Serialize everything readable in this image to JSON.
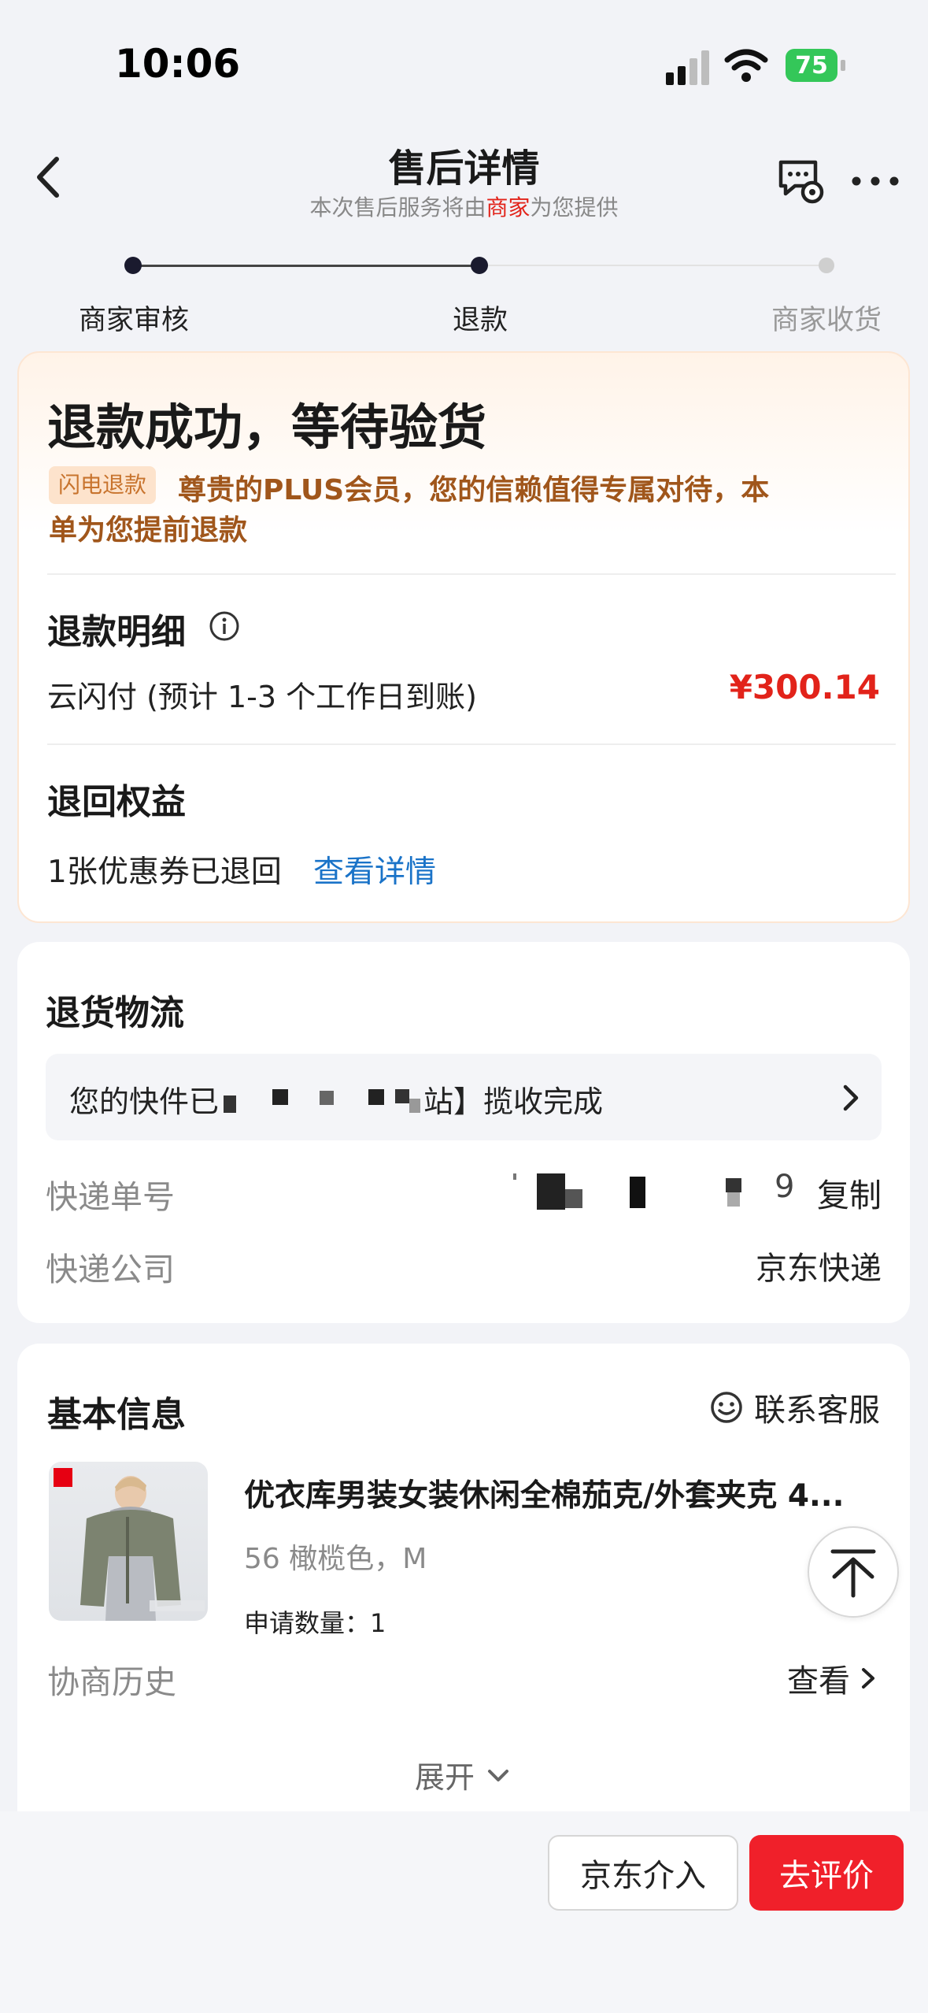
{
  "status_bar": {
    "time": "10:06",
    "battery": "75"
  },
  "header": {
    "title": "售后详情",
    "subtitle_prefix": "本次售后服务将由",
    "subtitle_highlight": "商家",
    "subtitle_suffix": "为您提供"
  },
  "progress": {
    "steps": [
      {
        "label": "商家审核",
        "state": "done"
      },
      {
        "label": "退款",
        "state": "current"
      },
      {
        "label": "商家收货",
        "state": "pending"
      }
    ]
  },
  "status_card": {
    "headline": "退款成功，等待验货",
    "tag": "闪电退款",
    "notice_line1": "尊贵的PLUS会员，您的信赖值得专属对待，本",
    "notice_line2": "单为您提前退款",
    "refund_detail_title": "退款明细",
    "refund_method": "云闪付 (预计 1-3 个工作日到账)",
    "refund_amount": "¥300.14",
    "rights_title": "退回权益",
    "coupon_text": "1张优惠券已退回",
    "coupon_link": "查看详情"
  },
  "logistics": {
    "title": "退货物流",
    "status_prefix": "您的快件已",
    "status_suffix": "站】揽收完成",
    "tracking_label": "快递单号",
    "tracking_visible_end": "9",
    "copy_label": "复制",
    "company_label": "快递公司",
    "company_value": "京东快递"
  },
  "basic_info": {
    "title": "基本信息",
    "contact_label": "联系客服",
    "product_name": "优衣库男装女装休闲全棉茄克/外套夹克 4...",
    "product_spec": "56 橄榄色，M",
    "quantity_label": "申请数量：",
    "quantity_value": "1",
    "history_label": "协商历史",
    "history_action": "查看",
    "expand_label": "展开",
    "product_image_brand": "UNI QLO"
  },
  "bottom_bar": {
    "jd_button": "京东介入",
    "review_button": "去评价"
  },
  "colors": {
    "accent_red": "#e2231a",
    "notice_brown": "#a0561b",
    "link_blue": "#1a73c8",
    "tag_bg": "#fde3cc",
    "button_red": "#f0202a"
  }
}
